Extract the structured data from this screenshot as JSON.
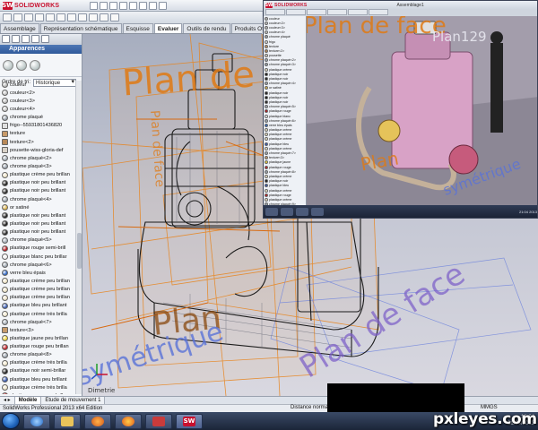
{
  "app": {
    "brand": "SOLIDWORKS",
    "logo_letters": "SW",
    "window_title": "SolidWorks Professional 2013 x64 Edition"
  },
  "command_tabs": [
    {
      "label": "Assemblage",
      "active": false
    },
    {
      "label": "Représentation schématique",
      "active": false
    },
    {
      "label": "Esquisse",
      "active": false
    },
    {
      "label": "Evaluer",
      "active": true
    },
    {
      "label": "Outils de rendu",
      "active": false
    },
    {
      "label": "Produits Office",
      "active": false
    }
  ],
  "panel": {
    "title": "Apparences",
    "sort_label": "Ordre de tri:",
    "sort_value": "Historique",
    "items": [
      {
        "label": "couleur",
        "swatch": "#b9b9b9",
        "shape": "round"
      },
      {
        "label": "couleur<2>",
        "swatch": "#c4c4c4",
        "shape": "round"
      },
      {
        "label": "couleur<3>",
        "swatch": "#bdbdbd",
        "shape": "round"
      },
      {
        "label": "couleur<4>",
        "swatch": "#c9c9c9",
        "shape": "round"
      },
      {
        "label": "chrome plaqué",
        "swatch": "#9aa3ad",
        "shape": "round"
      },
      {
        "label": "frigo--55931801436820",
        "swatch": "#e0e0e0",
        "shape": "square"
      },
      {
        "label": "texture",
        "swatch": "#c79a6a",
        "shape": "square"
      },
      {
        "label": "texture<2>",
        "swatch": "#b88959",
        "shape": "square"
      },
      {
        "label": "pousette-wiss-gloria-def",
        "swatch": "#d8d1c7",
        "shape": "square"
      },
      {
        "label": "chrome plaqué<2>",
        "swatch": "#a7b0ba",
        "shape": "round"
      },
      {
        "label": "chrome plaqué<3>",
        "swatch": "#9aa3ad",
        "shape": "round"
      },
      {
        "label": "plastique crème peu brillan",
        "swatch": "#efe5c9",
        "shape": "round"
      },
      {
        "label": "plastique noir peu brillant",
        "swatch": "#1a1a1a",
        "shape": "round"
      },
      {
        "label": "plastique noir peu brillant",
        "swatch": "#222222",
        "shape": "round"
      },
      {
        "label": "chrome plaqué<4>",
        "swatch": "#9fa8b2",
        "shape": "round"
      },
      {
        "label": "or satiné",
        "swatch": "#d9b24c",
        "shape": "round"
      },
      {
        "label": "plastique noir peu brillant",
        "swatch": "#1b1b1b",
        "shape": "round"
      },
      {
        "label": "plastique noir peu brillant",
        "swatch": "#151515",
        "shape": "round"
      },
      {
        "label": "plastique noir peu brillant",
        "swatch": "#202020",
        "shape": "round"
      },
      {
        "label": "chrome plaqué<5>",
        "swatch": "#a3acb6",
        "shape": "round"
      },
      {
        "label": "plastique rouge semi-brill",
        "swatch": "#b3141b",
        "shape": "round"
      },
      {
        "label": "plastique blanc peu brillar",
        "swatch": "#f4f4f4",
        "shape": "round"
      },
      {
        "label": "chrome plaqué<6>",
        "swatch": "#a0a9b3",
        "shape": "round"
      },
      {
        "label": "verre bleu épais",
        "swatch": "#2f67c5",
        "shape": "round"
      },
      {
        "label": "plastique crème peu brillan",
        "swatch": "#efe4c5",
        "shape": "round"
      },
      {
        "label": "plastique crème peu brillan",
        "swatch": "#ece2c3",
        "shape": "round"
      },
      {
        "label": "plastique crème peu brillan",
        "swatch": "#eee3c7",
        "shape": "round"
      },
      {
        "label": "plastique bleu peu brillant",
        "swatch": "#3a5db3",
        "shape": "round"
      },
      {
        "label": "plastique crème très brilla",
        "swatch": "#f2e9cf",
        "shape": "round"
      },
      {
        "label": "chrome plaqué<7>",
        "swatch": "#a6afb9",
        "shape": "round"
      },
      {
        "label": "texture<3>",
        "swatch": "#c69a6b",
        "shape": "square"
      },
      {
        "label": "plastique jaune peu brillan",
        "swatch": "#f0d43a",
        "shape": "round"
      },
      {
        "label": "plastique rouge peu brillan",
        "swatch": "#c31d25",
        "shape": "round"
      },
      {
        "label": "chrome plaqué<8>",
        "swatch": "#9ea7b1",
        "shape": "round"
      },
      {
        "label": "plastique crème très brilla",
        "swatch": "#f1e7cb",
        "shape": "round"
      },
      {
        "label": "plastique noir semi-brillar",
        "swatch": "#191919",
        "shape": "round"
      },
      {
        "label": "plastique bleu peu brillant",
        "swatch": "#3557ad",
        "shape": "round"
      },
      {
        "label": "plastique crème très brilla",
        "swatch": "#f0e6ca",
        "shape": "round"
      },
      {
        "label": "plastique rouge peu brilla",
        "swatch": "#bf1c22",
        "shape": "round"
      },
      {
        "label": "plastique crème semi-brill",
        "swatch": "#eee4c6",
        "shape": "round"
      },
      {
        "label": "chrome plaqué<9>",
        "swatch": "#a1aab4",
        "shape": "round"
      }
    ]
  },
  "watermark": {
    "text_a": "Plan de face",
    "text_b": "Plan129",
    "text_c": "symétrique",
    "text_d": "Plan de face",
    "text_e": "Plan",
    "text_f": "Plan de face",
    "text_g": "Dimetrie",
    "color_orange": "#e07a14",
    "color_purple": "#7a5cc8",
    "color_blue": "#5a73d8"
  },
  "inset": {
    "title": "Assemblage1",
    "clock": "21:04 2013",
    "items": [
      "couleur",
      "couleur<2>",
      "couleur<3>",
      "couleur<4>",
      "chrome plaqué",
      "frigo",
      "texture",
      "texture<2>",
      "pousette",
      "chrome plaqué<2>",
      "chrome plaqué<3>",
      "plastique crème",
      "plastique noir",
      "plastique noir",
      "chrome plaqué<4>",
      "or satiné",
      "plastique noir",
      "plastique noir",
      "plastique noir",
      "chrome plaqué<5>",
      "plastique rouge",
      "plastique blanc",
      "chrome plaqué<6>",
      "verre bleu épais",
      "plastique crème",
      "plastique crème",
      "plastique crème",
      "plastique bleu",
      "plastique crème",
      "chrome plaqué<7>",
      "texture<3>",
      "plastique jaune",
      "plastique rouge",
      "chrome plaqué<8>",
      "plastique crème",
      "plastique noir",
      "plastique bleu",
      "plastique crème",
      "plastique rouge",
      "plastique crème",
      "chrome plaqué<9>"
    ]
  },
  "bottom_tabs": [
    {
      "label": "Modèle",
      "active": true
    },
    {
      "label": "Etude de mouvement 1",
      "active": false
    }
  ],
  "status": {
    "left": "SolidWorks Professional 2013 x64 Edition",
    "middle": "Distance norma",
    "units": "MMGS"
  },
  "taskbar": {
    "clock_time": "18:04",
    "clock_date": "21/04/2013"
  },
  "credit": "pxleyes.com"
}
